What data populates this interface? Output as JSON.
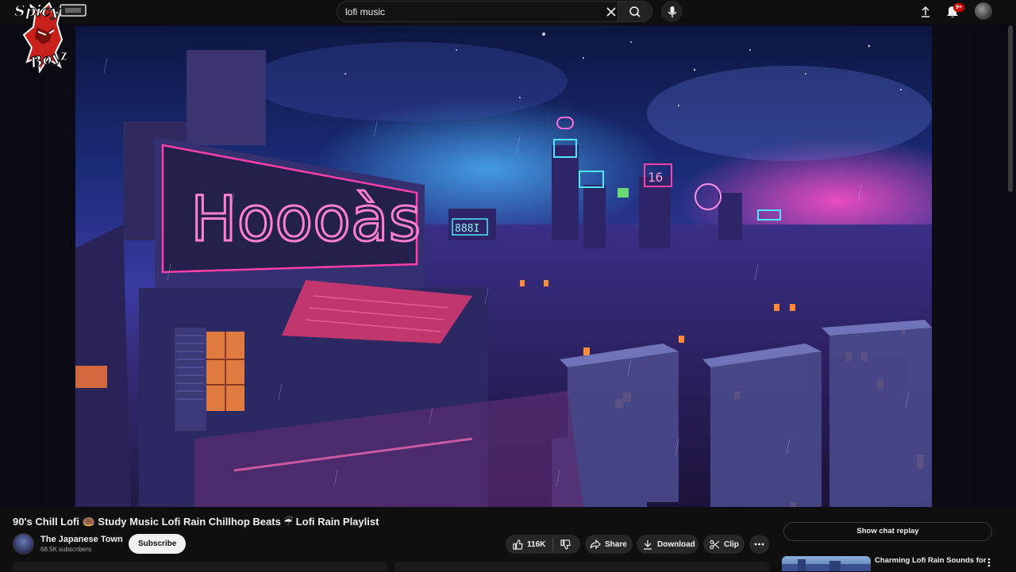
{
  "search": {
    "value": "lofi music",
    "placeholder": "Search"
  },
  "notifications": {
    "badge": "9+"
  },
  "logo": {
    "text_top": "Spicy",
    "text_bottom": "Boyz"
  },
  "video": {
    "title": "90's Chill Lofi 🍩 Study Music Lofi Rain Chillhop Beats ☔ Lofi Rain Playlist",
    "neon_sign": "Hoooàs",
    "neon_small": "888I"
  },
  "channel": {
    "name": "The Japanese Town",
    "subscribers": "68.5K subscribers",
    "subscribe_label": "Subscribe"
  },
  "actions": {
    "likes": "116K",
    "share": "Share",
    "download": "Download",
    "clip": "Clip"
  },
  "sidebar": {
    "chat_replay": "Show chat replay",
    "recommendations": [
      {
        "title": "Charming Lofi Rain Sounds for"
      }
    ]
  },
  "colors": {
    "accent_red": "#cc0000",
    "neon_pink": "#ff3fa8",
    "neon_cyan": "#4fe7ff"
  }
}
